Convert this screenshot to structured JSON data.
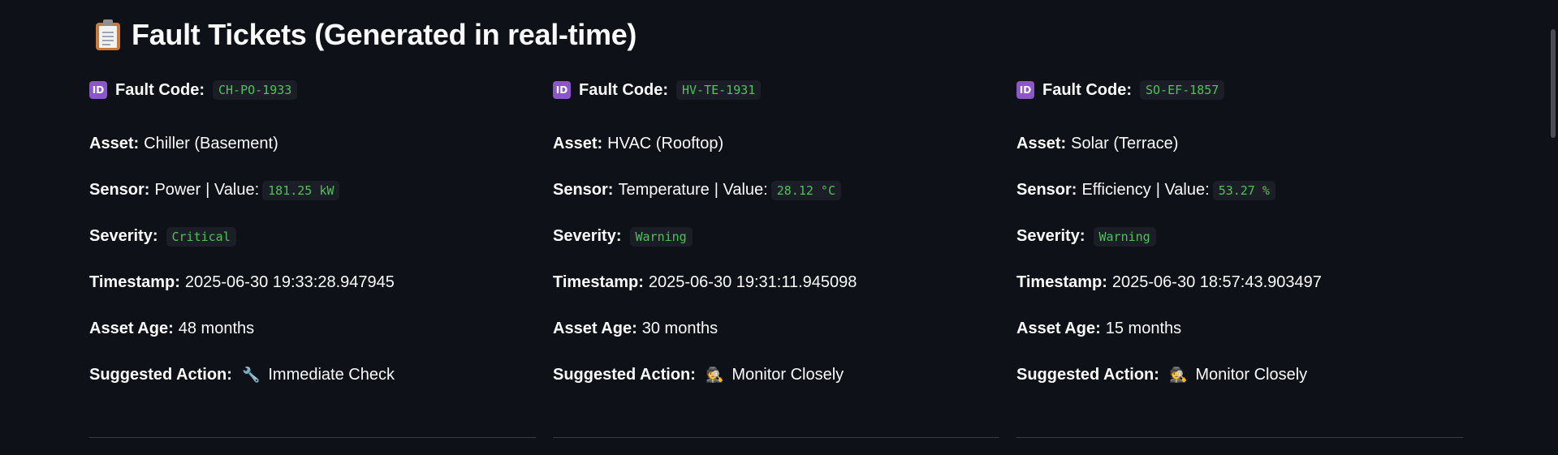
{
  "header": {
    "icon": "clipboard-icon",
    "title": "Fault Tickets (Generated in real-time)"
  },
  "labels": {
    "fault_code": "Fault Code:",
    "asset": "Asset:",
    "sensor": "Sensor:",
    "value_sep": "| Value:",
    "severity": "Severity:",
    "timestamp": "Timestamp:",
    "asset_age": "Asset Age:",
    "suggested_action": "Suggested Action:"
  },
  "tickets": [
    {
      "fault_code": "CH-PO-1933",
      "asset": "Chiller (Basement)",
      "sensor": "Power",
      "value": "181.25 kW",
      "severity": "Critical",
      "timestamp": "2025-06-30 19:33:28.947945",
      "asset_age": "48 months",
      "action_icon": "wrench-icon",
      "suggested_action": "Immediate Check"
    },
    {
      "fault_code": "HV-TE-1931",
      "asset": "HVAC (Rooftop)",
      "sensor": "Temperature",
      "value": "28.12 °C",
      "severity": "Warning",
      "timestamp": "2025-06-30 19:31:11.945098",
      "asset_age": "30 months",
      "action_icon": "detective-icon",
      "suggested_action": "Monitor Closely"
    },
    {
      "fault_code": "SO-EF-1857",
      "asset": "Solar (Terrace)",
      "sensor": "Efficiency",
      "value": "53.27 %",
      "severity": "Warning",
      "timestamp": "2025-06-30 18:57:43.903497",
      "asset_age": "15 months",
      "action_icon": "detective-icon",
      "suggested_action": "Monitor Closely"
    }
  ],
  "colors": {
    "background": "#0e1117",
    "code_text": "#4ec257",
    "code_bg": "#1b1e26",
    "id_badge": "#8b56c8"
  }
}
